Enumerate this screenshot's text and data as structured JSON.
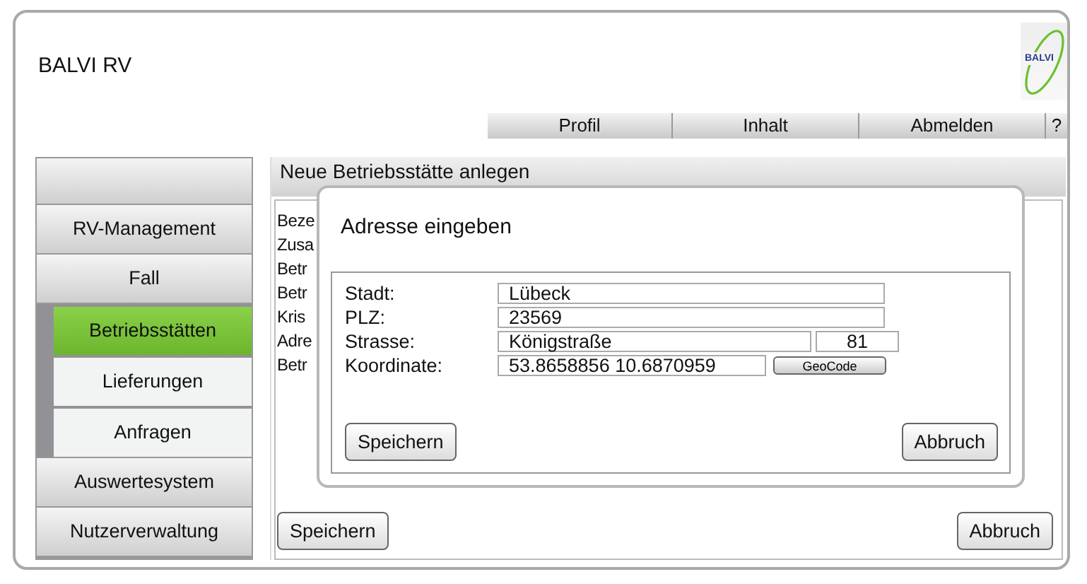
{
  "app": {
    "title": "BALVI RV",
    "logo": "BALVI"
  },
  "nav": [
    {
      "label": "Profil"
    },
    {
      "label": "Inhalt"
    },
    {
      "label": "Abmelden"
    },
    {
      "label": "?"
    }
  ],
  "sidebar": {
    "items": [
      {
        "label": "RV-Management",
        "selected": false
      },
      {
        "label": "Fall",
        "selected": false,
        "expanded": true,
        "children": [
          {
            "label": "Betriebsstätten",
            "selected": true
          },
          {
            "label": "Lieferungen",
            "selected": false
          },
          {
            "label": "Anfragen",
            "selected": false
          }
        ]
      },
      {
        "label": "Auswertesystem",
        "selected": false
      },
      {
        "label": "Nutzerverwaltung",
        "selected": false
      }
    ]
  },
  "form": {
    "title": "Neue Betriebsstätte anlegen",
    "fields": [
      {
        "label": "Beze"
      },
      {
        "label": "Zusa"
      },
      {
        "label": "Betr"
      },
      {
        "label": "Betr"
      },
      {
        "label": "Kris"
      },
      {
        "label": "Adre"
      },
      {
        "label": "Betr"
      }
    ],
    "buttons": [
      "Speichern",
      "Abbruch"
    ]
  },
  "dialog": {
    "title": "Adresse eingeben",
    "fields": [
      {
        "label": "Stadt:",
        "value": "Lübeck"
      },
      {
        "label": "PLZ:",
        "value": "23569"
      },
      {
        "label": "Strasse:",
        "value": "Königstraße",
        "number": "81"
      },
      {
        "label": "Koordinate:",
        "value": "53.8658856 10.6870959",
        "button": "GeoCode"
      }
    ],
    "buttons": [
      "Speichern",
      "Abbruch"
    ]
  }
}
